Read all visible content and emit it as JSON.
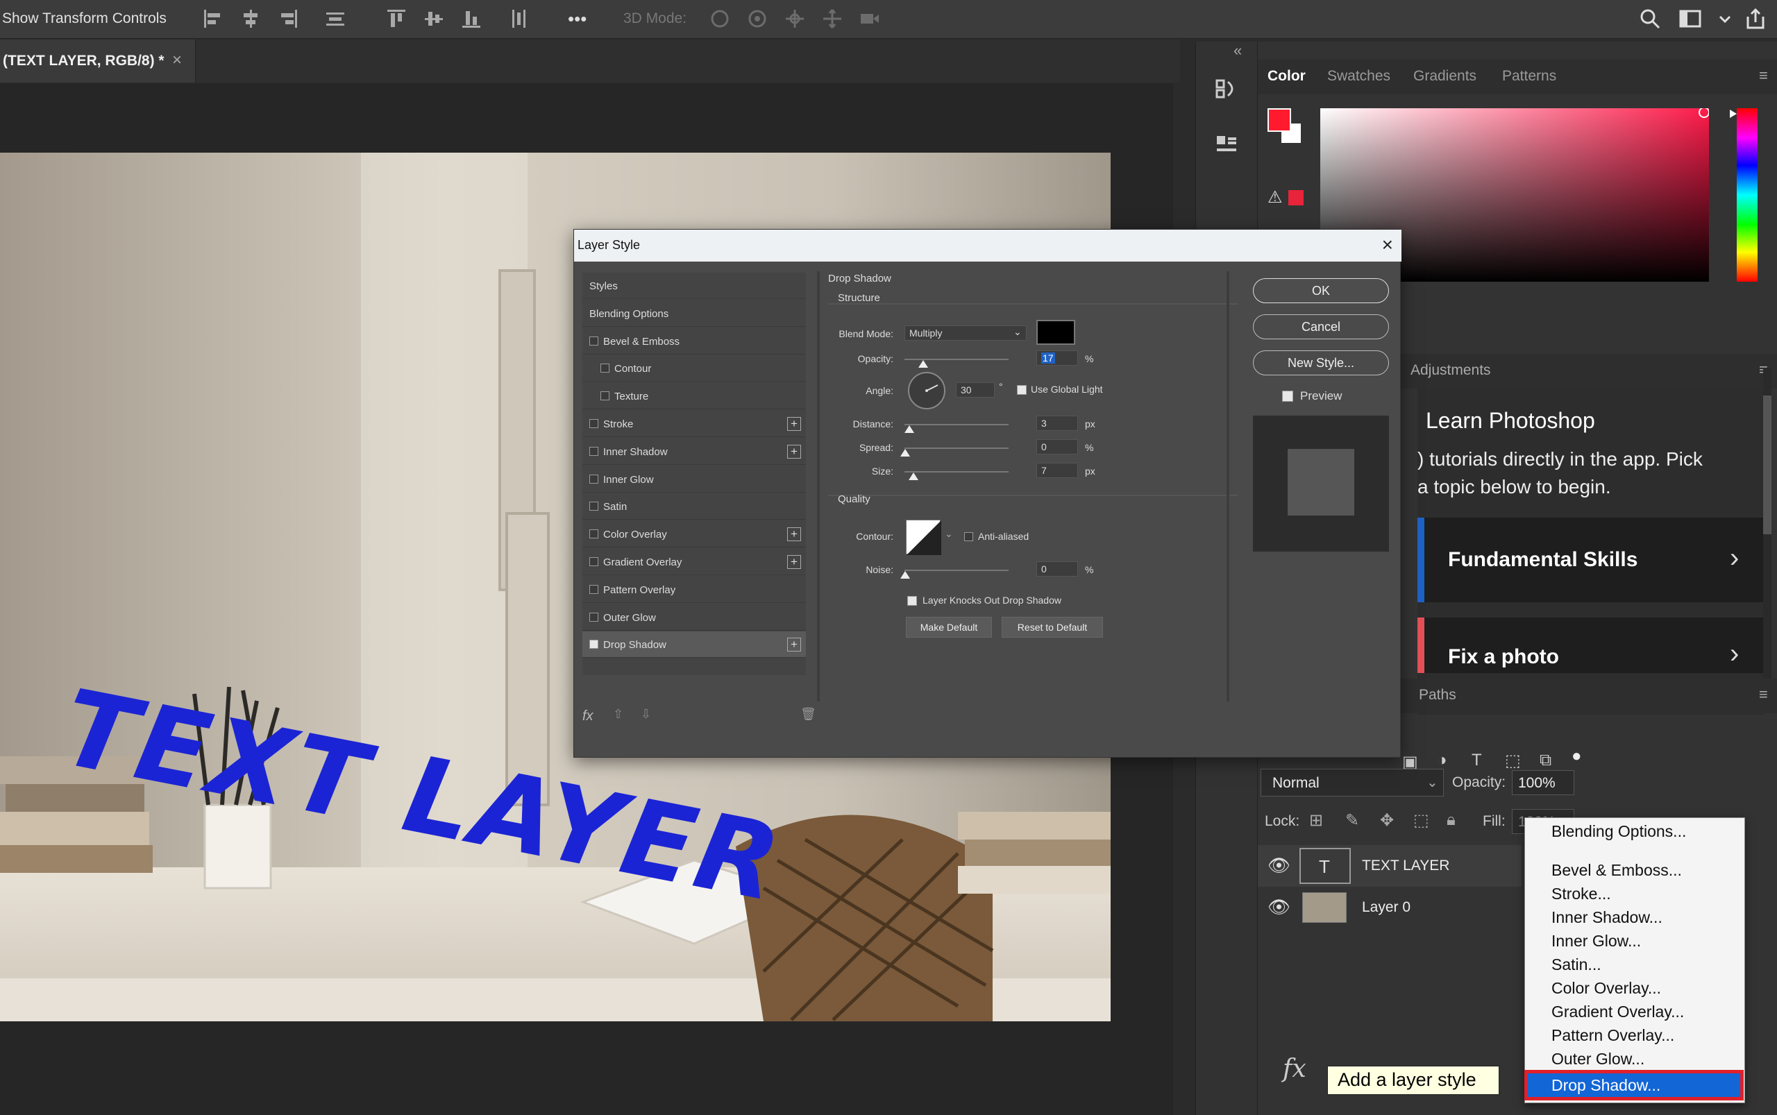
{
  "options_bar": {
    "show_transform_label": "Show Transform Controls",
    "mode_3d_label": "3D Mode:",
    "more_label": "•••"
  },
  "document": {
    "tab_title": "(TEXT LAYER, RGB/8) *",
    "close_glyph": "×",
    "canvas_text": "TEXT LAYER"
  },
  "panels": {
    "collapse_glyph": "«",
    "color_tabs": [
      "Color",
      "Swatches",
      "Gradients",
      "Patterns"
    ],
    "adjustments_title": "Adjustments",
    "learn_title": "Learn Photoshop",
    "learn_body": ") tutorials directly in the app. Pick a topic below to begin.",
    "learn_cards": [
      "Fundamental Skills",
      "Fix a photo"
    ],
    "paths_title": "Paths",
    "colors": {
      "foreground": "#ff1b2d",
      "background": "#ffffff",
      "warning_swatch": "#e8243a"
    }
  },
  "layers": {
    "blend_mode": "Normal",
    "opacity_label": "Opacity:",
    "opacity_value": "100%",
    "lock_label": "Lock:",
    "fill_label": "Fill:",
    "fill_value": "100%",
    "items": [
      {
        "name": "TEXT LAYER",
        "thumb": "T"
      },
      {
        "name": "Layer 0",
        "thumb": ""
      }
    ],
    "fx_label": "fx",
    "tooltip": "Add a layer style"
  },
  "dialog": {
    "title": "Layer Style",
    "styles_header": "Styles",
    "blending_options": "Blending Options",
    "effects": [
      {
        "label": "Bevel & Emboss",
        "checked": false,
        "plus": false,
        "indent": false
      },
      {
        "label": "Contour",
        "checked": false,
        "plus": false,
        "indent": true
      },
      {
        "label": "Texture",
        "checked": false,
        "plus": false,
        "indent": true
      },
      {
        "label": "Stroke",
        "checked": false,
        "plus": true,
        "indent": false
      },
      {
        "label": "Inner Shadow",
        "checked": false,
        "plus": true,
        "indent": false
      },
      {
        "label": "Inner Glow",
        "checked": false,
        "plus": false,
        "indent": false
      },
      {
        "label": "Satin",
        "checked": false,
        "plus": false,
        "indent": false
      },
      {
        "label": "Color Overlay",
        "checked": false,
        "plus": true,
        "indent": false
      },
      {
        "label": "Gradient Overlay",
        "checked": false,
        "plus": true,
        "indent": false
      },
      {
        "label": "Pattern Overlay",
        "checked": false,
        "plus": false,
        "indent": false
      },
      {
        "label": "Outer Glow",
        "checked": false,
        "plus": false,
        "indent": false
      },
      {
        "label": "Drop Shadow",
        "checked": true,
        "plus": true,
        "indent": false
      }
    ],
    "fx_glyph": "fx",
    "section_title": "Drop Shadow",
    "structure_title": "Structure",
    "blend_mode_label": "Blend Mode:",
    "blend_mode_value": "Multiply",
    "shadow_color": "#000000",
    "opacity_label": "Opacity:",
    "opacity_value": "17",
    "angle_label": "Angle:",
    "angle_value": "30",
    "degree_glyph": "°",
    "use_global_light": "Use Global Light",
    "distance_label": "Distance:",
    "distance_value": "3",
    "spread_label": "Spread:",
    "spread_value": "0",
    "size_label": "Size:",
    "size_value": "7",
    "unit_px": "px",
    "unit_pct": "%",
    "quality_title": "Quality",
    "contour_label": "Contour:",
    "anti_aliased": "Anti-aliased",
    "noise_label": "Noise:",
    "noise_value": "0",
    "knocks_out": "Layer Knocks Out Drop Shadow",
    "make_default": "Make Default",
    "reset_default": "Reset to Default",
    "ok": "OK",
    "cancel": "Cancel",
    "new_style": "New Style...",
    "preview": "Preview"
  },
  "context_menu": {
    "items": [
      "Blending Options...",
      "Bevel & Emboss...",
      "Stroke...",
      "Inner Shadow...",
      "Inner Glow...",
      "Satin...",
      "Color Overlay...",
      "Gradient Overlay...",
      "Pattern Overlay...",
      "Outer Glow...",
      "Drop Shadow..."
    ],
    "highlighted": "Drop Shadow...",
    "highlight_color": "#1366d6",
    "outline_color": "#e0202a"
  }
}
